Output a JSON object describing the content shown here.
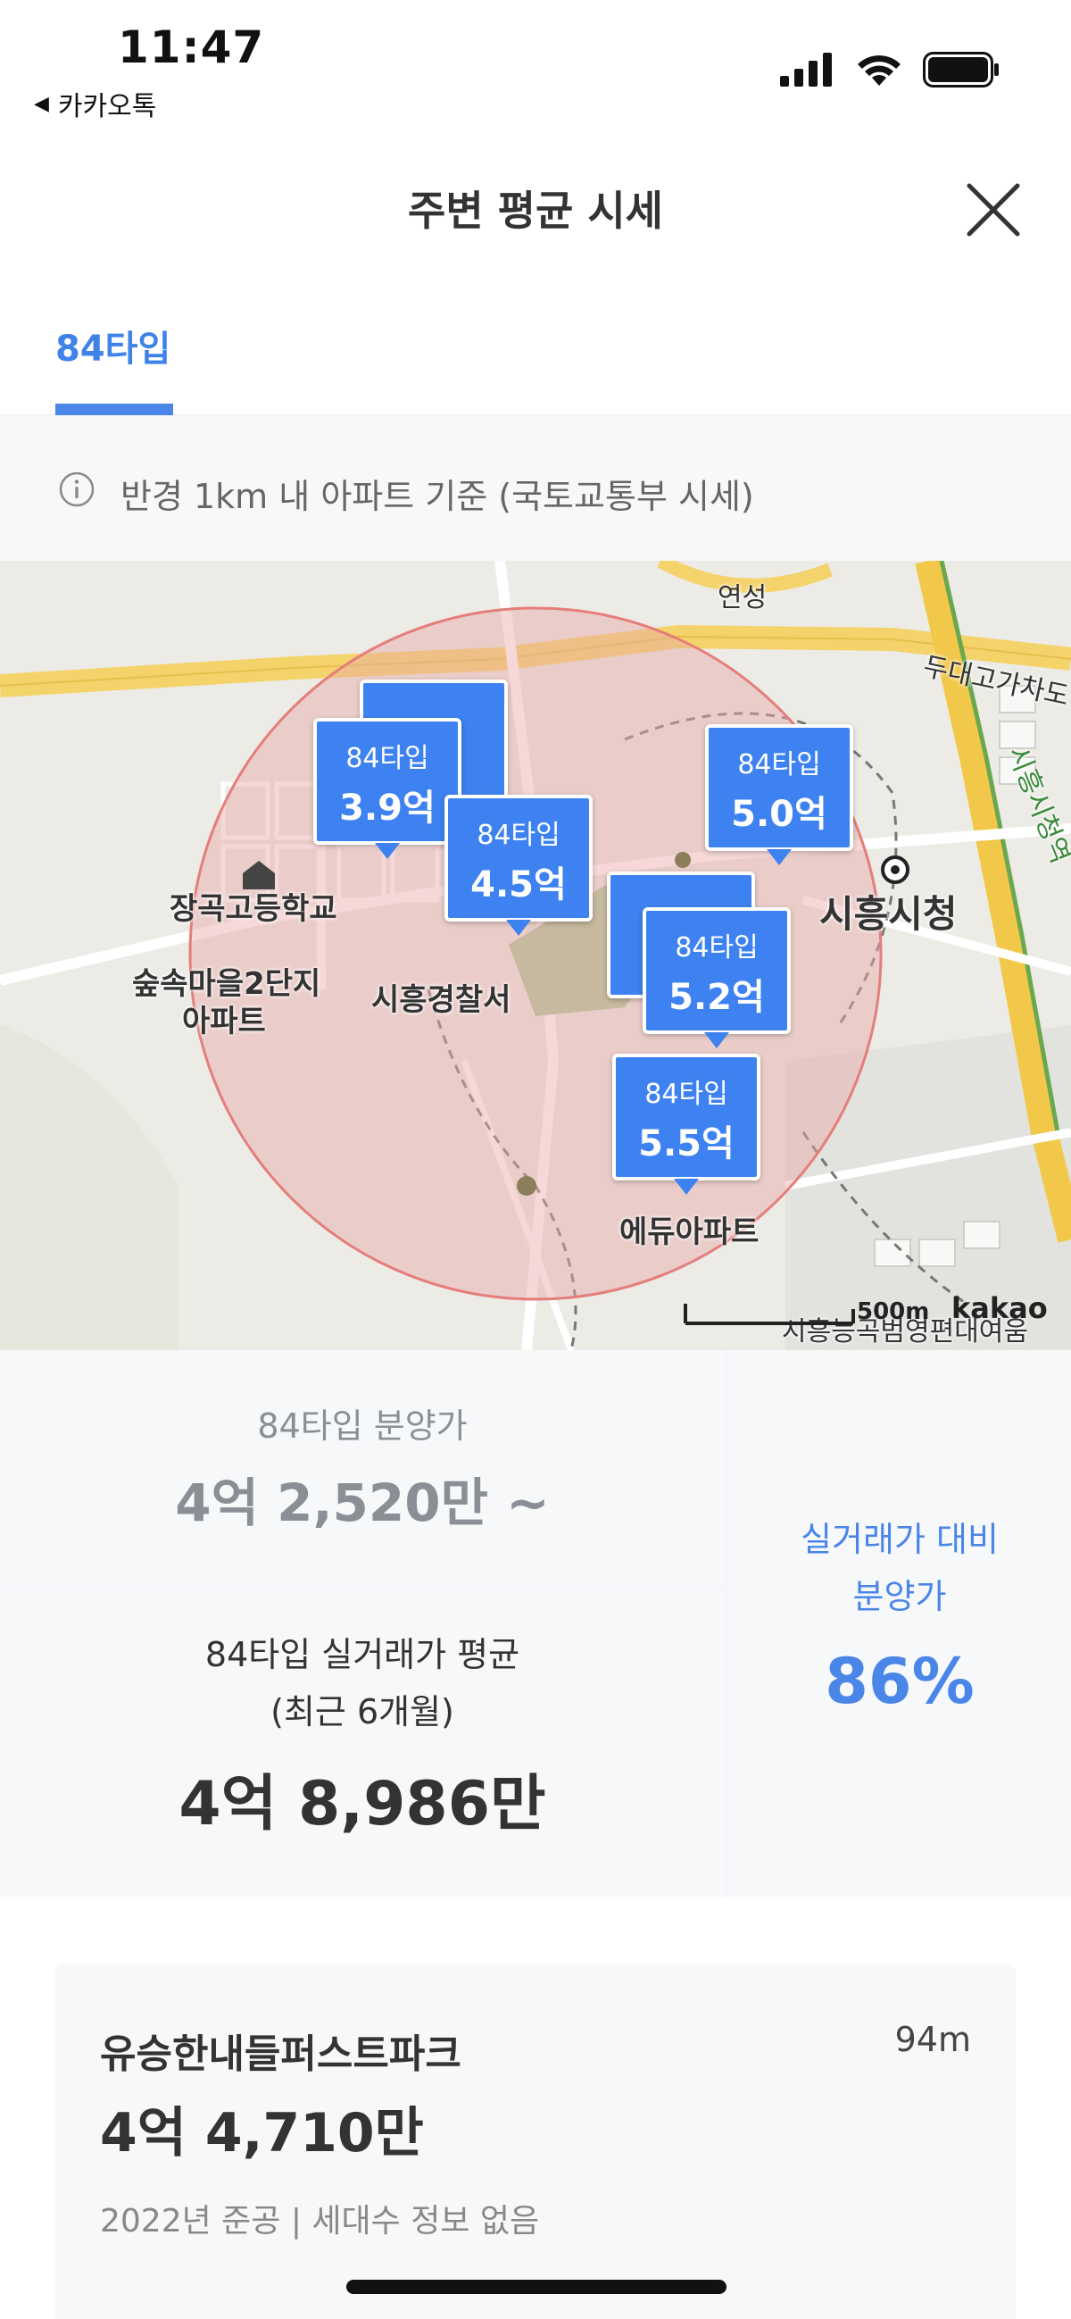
{
  "status_bar": {
    "time": "11:47",
    "back_app": "카카오톡"
  },
  "header": {
    "title": "주변 평균 시세"
  },
  "tabs": [
    {
      "label": "84타입",
      "active": true
    }
  ],
  "info": {
    "text": "반경 1km 내 아파트 기준 (국토교통부 시세)"
  },
  "map": {
    "pins": [
      {
        "type": "84타입",
        "price": "3.9억"
      },
      {
        "type": "84타입",
        "price": "4.5억"
      },
      {
        "type": "84타입",
        "price": "5.0억"
      },
      {
        "type": "84타입",
        "price": "5.2억"
      },
      {
        "type": "84타입",
        "price": "5.5억"
      }
    ],
    "labels": {
      "yeonseong": "연성",
      "dudae": "두대고가차도",
      "janggok_school": "장곡고등학교",
      "supsok": "숲속마을2단지",
      "apart": "아파트",
      "police": "시흥경찰서",
      "cityhall": "시흥시청",
      "cityhall_station": "시흥시청역",
      "edu": "에듀아파트",
      "bottom_right": "시흥능곡범영편대여움"
    },
    "scale": "500m",
    "logo": "kakao",
    "colors": {
      "pin": "#3d82f0",
      "radius_fill": "#e8a9a6",
      "road_yellow": "#f5d36b"
    }
  },
  "summary": {
    "presale_label": "84타입 분양가",
    "presale_value": "4억 2,520만 ~",
    "actual_label_1": "84타입 실거래가 평균",
    "actual_label_2": "(최근 6개월)",
    "actual_value": "4억 8,986만",
    "ratio_label_1": "실거래가 대비",
    "ratio_label_2": "분양가",
    "ratio_value": "86%"
  },
  "listing": {
    "name": "유승한내들퍼스트파크",
    "distance": "94m",
    "price": "4억 4,710만",
    "meta": "2022년 준공 | 세대수 정보 없음"
  }
}
